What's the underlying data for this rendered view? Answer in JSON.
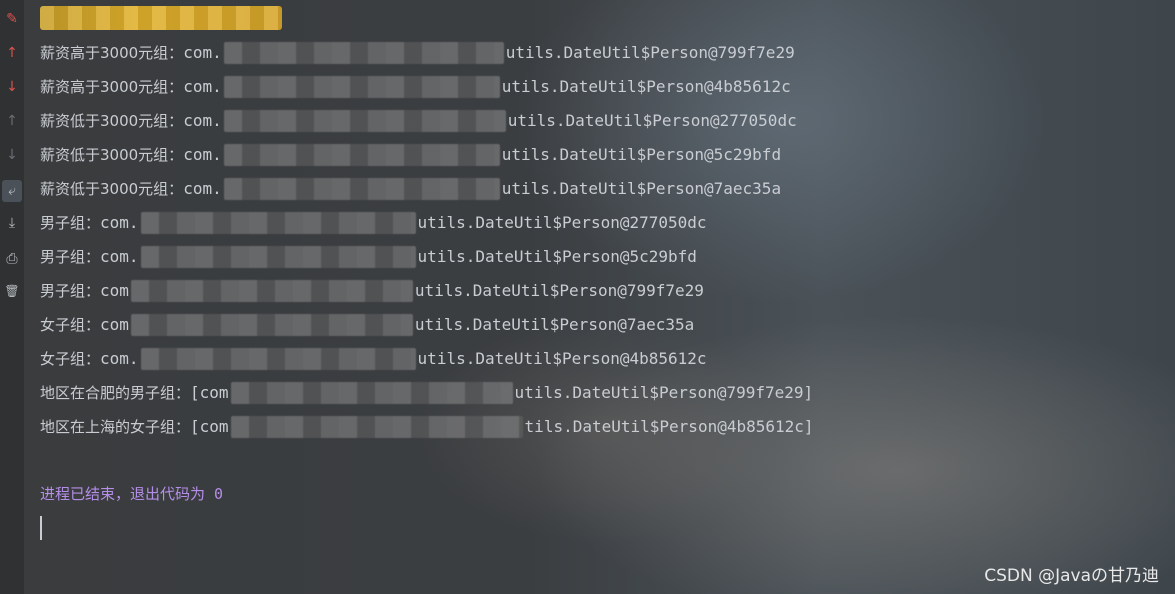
{
  "gutter": [
    {
      "icon": "pencil-icon",
      "glyph": "✎"
    },
    {
      "icon": "arrow-up-icon",
      "glyph": "↑"
    },
    {
      "icon": "arrow-down-icon",
      "glyph": "↓"
    },
    {
      "icon": "arrow-up-icon",
      "glyph": "↑"
    },
    {
      "icon": "arrow-down-icon",
      "glyph": "↓"
    },
    {
      "icon": "soft-wrap-icon",
      "glyph": "⤶"
    },
    {
      "icon": "scroll-to-end-icon",
      "glyph": "⤓"
    },
    {
      "icon": "print-icon",
      "glyph": "⎙"
    },
    {
      "icon": "trash-icon",
      "glyph": "🗑"
    }
  ],
  "console": {
    "lines": [
      {
        "label": "薪资高于3000元组：",
        "prefix": "com.",
        "suffix": "utils.DateUtil$Person@799f7e29"
      },
      {
        "label": "薪资高于3000元组：",
        "prefix": "com.",
        "suffix": "utils.DateUtil$Person@4b85612c"
      },
      {
        "label": "薪资低于3000元组：",
        "prefix": "com.",
        "suffix": "utils.DateUtil$Person@277050dc"
      },
      {
        "label": "薪资低于3000元组：",
        "prefix": "com.",
        "suffix": "utils.DateUtil$Person@5c29bfd"
      },
      {
        "label": "薪资低于3000元组：",
        "prefix": "com.",
        "suffix": "utils.DateUtil$Person@7aec35a"
      },
      {
        "label": "男子组：",
        "prefix": "com.",
        "suffix": "utils.DateUtil$Person@277050dc"
      },
      {
        "label": "男子组：",
        "prefix": "com.",
        "suffix": "utils.DateUtil$Person@5c29bfd"
      },
      {
        "label": "男子组：",
        "prefix": "com",
        "suffix": "utils.DateUtil$Person@799f7e29"
      },
      {
        "label": "女子组：",
        "prefix": "com",
        "suffix": "utils.DateUtil$Person@7aec35a"
      },
      {
        "label": "女子组：",
        "prefix": "com.",
        "suffix": "utils.DateUtil$Person@4b85612c"
      },
      {
        "label": "地区在合肥的男子组：",
        "prefix": "[com",
        "suffix": "utils.DateUtil$Person@799f7e29]"
      },
      {
        "label": "地区在上海的女子组：",
        "prefix": "[com",
        "suffix": "tils.DateUtil$Person@4b85612c]"
      }
    ],
    "status_text": "进程已结束，退出代码为",
    "exit_code": "0"
  },
  "watermark": "CSDN @Javaの甘乃迪",
  "colors": {
    "text": "#c9cdd2",
    "status": "#b58ee8",
    "accent_red": "#d9534f",
    "title_mask": "#e0b02c"
  }
}
